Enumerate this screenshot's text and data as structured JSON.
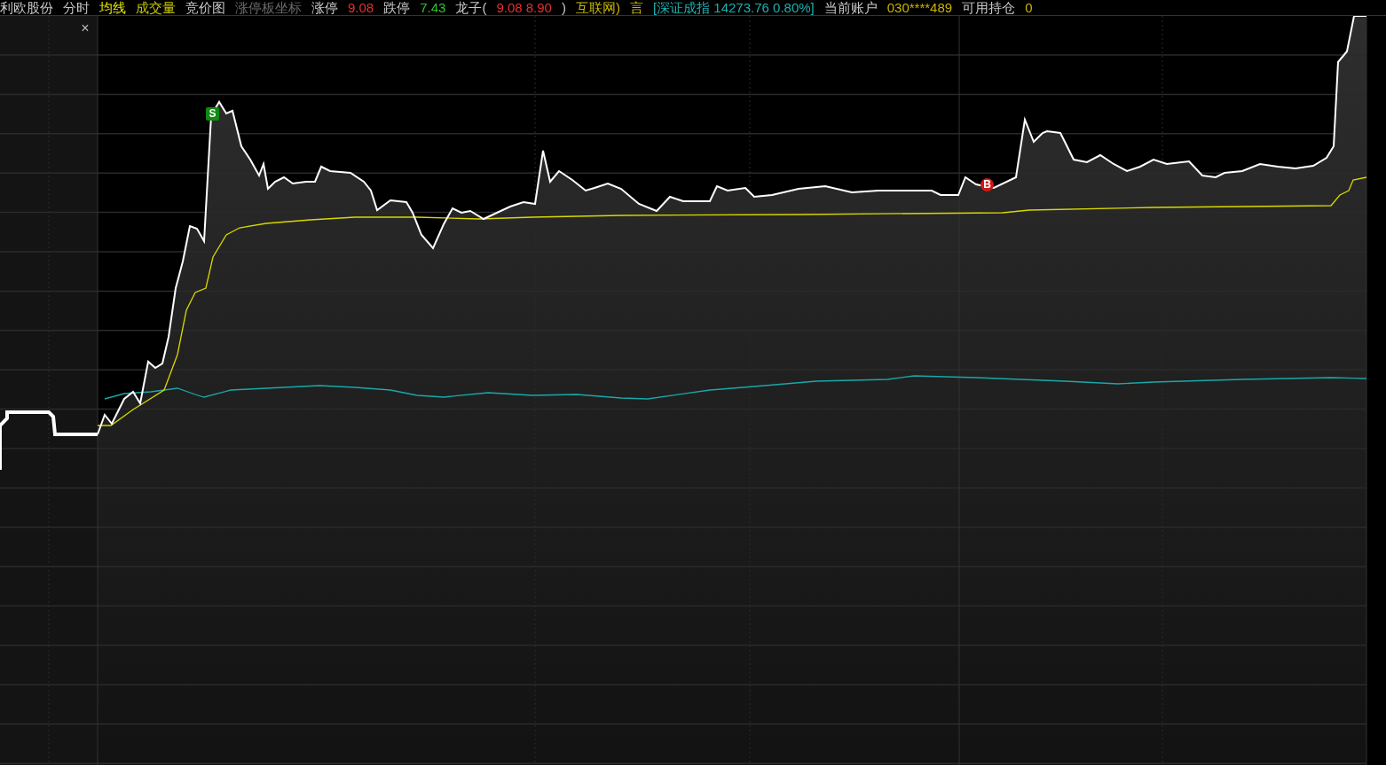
{
  "header": [
    {
      "text": "利欧股份",
      "color": "#c8c8c8"
    },
    {
      "text": "分时",
      "color": "#c8c8c8"
    },
    {
      "text": "均线",
      "color": "#e6e600"
    },
    {
      "text": "成交量",
      "color": "#c8c800"
    },
    {
      "text": "竞价图",
      "color": "#c8c8c8"
    },
    {
      "text": "涨停板坐标",
      "color": "#6a6a6a"
    },
    {
      "text": "涨停",
      "color": "#c8c8c8"
    },
    {
      "text": "9.08",
      "color": "#e03030"
    },
    {
      "text": "跌停",
      "color": "#c8c8c8"
    },
    {
      "text": "7.43",
      "color": "#30c030"
    },
    {
      "text": "龙子(",
      "color": "#c8c8c8"
    },
    {
      "text": "9.08 8.90",
      "color": "#e03030"
    },
    {
      "text": ")",
      "color": "#c8c8c8"
    },
    {
      "text": "互联网)",
      "color": "#c8b400"
    },
    {
      "text": "言",
      "color": "#c8b400"
    },
    {
      "text": "[深证成指 14273.76 0.80%]",
      "color": "#1ab0b0"
    },
    {
      "text": "当前账户",
      "color": "#c8c8c8"
    },
    {
      "text": "030****489",
      "color": "#c8b400"
    },
    {
      "text": "可用持仓",
      "color": "#c8c8c8"
    },
    {
      "text": "0",
      "color": "#c8b400"
    }
  ],
  "close_button": "×",
  "markers": [
    {
      "kind": "sell",
      "label": "S"
    },
    {
      "kind": "buy",
      "label": "B"
    }
  ]
}
